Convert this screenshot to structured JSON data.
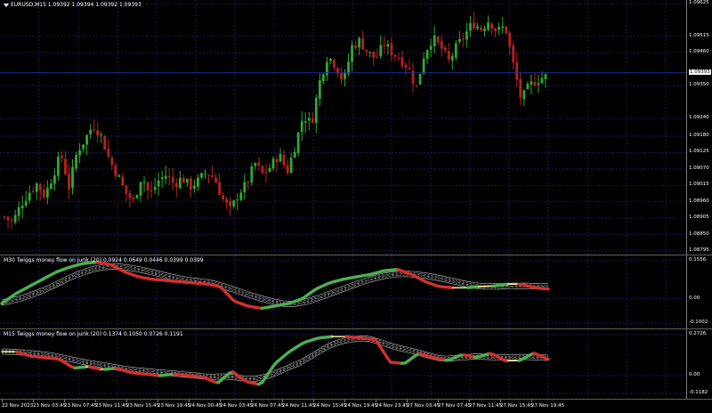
{
  "main_pane": {
    "title": "EURUSD,M15  1.09392 1.09394 1.09392 1.09393",
    "current_price": "1.09393",
    "y_labels": [
      "1.09625",
      "1.09515",
      "1.09460",
      "1.09350",
      "1.09240",
      "1.09180",
      "1.09125",
      "1.09070",
      "1.09015",
      "1.08960",
      "1.08905",
      "1.08850",
      "1.08795"
    ],
    "y_values": [
      1.09625,
      1.09515,
      1.0946,
      1.0935,
      1.0924,
      1.0918,
      1.09125,
      1.0907,
      1.09015,
      1.0896,
      1.08905,
      1.0885,
      1.08795
    ],
    "ylim": [
      1.08795,
      1.09625
    ]
  },
  "indicator_m30": {
    "title": "M30 Twiggs money flow on jurik (20) 0.0924 0.0649 0.0446 0.0399 0.0399",
    "y_labels": [
      "0.1556",
      "0.00",
      "-0.1002"
    ],
    "ylim": [
      -0.1002,
      0.1556
    ]
  },
  "indicator_m15": {
    "title": "M15 Twiggs money flow on jurik (20) 0.1374 0.1050 0.0726 0.1191",
    "y_labels": [
      "0.2726",
      "0.00",
      "-0.1182"
    ],
    "ylim": [
      -0.1182,
      0.2726
    ]
  },
  "x_labels": [
    "22 Nov 2023",
    "23 Nov 03:45",
    "23 Nov 07:45",
    "23 Nov 11:45",
    "23 Nov 15:45",
    "23 Nov 19:45",
    "24 Nov 00:45",
    "24 Nov 03:45",
    "24 Nov 07:45",
    "24 Nov 11:45",
    "24 Nov 15:45",
    "24 Nov 19:45",
    "24 Nov 23:45",
    "27 Nov 03:45",
    "27 Nov 07:45",
    "27 Nov 11:45",
    "27 Nov 15:45",
    "27 Nov 19:45"
  ],
  "colors": {
    "bull_candle": "#2fa82f",
    "bear_candle": "#b82020",
    "grid": "#1a1a5a",
    "price_line": "#1a2fa0",
    "up_flow": "#4caf50",
    "down_flow": "#d32f2f",
    "neutral_flow": "#f2e88a",
    "bands": "#c8c8c8"
  },
  "chart_data": [
    {
      "type": "candlestick",
      "title": "EURUSD,M15",
      "y_range": [
        1.08795,
        1.09625
      ],
      "close_path": [
        1.0891,
        1.0889,
        1.0895,
        1.0899,
        1.0902,
        1.0898,
        1.0905,
        1.0912,
        1.0901,
        1.0913,
        1.0917,
        1.0922,
        1.0918,
        1.091,
        1.0905,
        1.0899,
        1.0896,
        1.0905,
        1.0898,
        1.0903,
        1.0905,
        1.0902,
        1.0904,
        1.0901,
        1.0903,
        1.0906,
        1.0904,
        1.0897,
        1.0893,
        1.0899,
        1.0902,
        1.0909,
        1.0905,
        1.0908,
        1.0912,
        1.0906,
        1.0915,
        1.0925,
        1.0922,
        1.0936,
        1.0945,
        1.0942,
        1.0936,
        1.0948,
        1.095,
        1.0946,
        1.0944,
        1.0949,
        1.0946,
        1.0944,
        1.0941,
        1.0934,
        1.0946,
        1.0951,
        1.0948,
        1.0943,
        1.0948,
        1.0952,
        1.0956,
        1.0954,
        1.0957,
        1.0953,
        1.0955,
        1.0942,
        1.093,
        1.0935,
        1.0937,
        1.0938
      ]
    },
    {
      "type": "line",
      "title": "M30 Twiggs money flow on jurik (20)",
      "y_range": [
        -0.1002,
        0.1556
      ],
      "series_path": [
        -0.02,
        0.02,
        0.05,
        0.08,
        0.11,
        0.13,
        0.145,
        0.15,
        0.14,
        0.11,
        0.09,
        0.08,
        0.075,
        0.07,
        0.065,
        0.06,
        0.05,
        -0.01,
        -0.03,
        -0.04,
        -0.03,
        -0.02,
        0.0,
        0.04,
        0.065,
        0.08,
        0.09,
        0.1,
        0.115,
        0.12,
        0.1,
        0.07,
        0.05,
        0.045,
        0.045,
        0.05,
        0.052,
        0.06,
        0.06,
        0.045,
        0.04
      ]
    },
    {
      "type": "line",
      "title": "M15 Twiggs money flow on jurik (20)",
      "y_range": [
        -0.1182,
        0.2726
      ],
      "series_path": [
        0.16,
        0.16,
        0.13,
        0.12,
        0.11,
        0.05,
        0.06,
        0.04,
        0.05,
        0.02,
        0.01,
        0.0,
        0.01,
        0.0,
        -0.01,
        -0.05,
        0.03,
        -0.04,
        -0.06,
        0.08,
        0.16,
        0.22,
        0.25,
        0.26,
        0.26,
        0.25,
        0.24,
        0.09,
        0.08,
        0.15,
        0.12,
        0.1,
        0.14,
        0.12,
        0.15,
        0.1,
        0.1,
        0.15,
        0.11
      ]
    }
  ]
}
